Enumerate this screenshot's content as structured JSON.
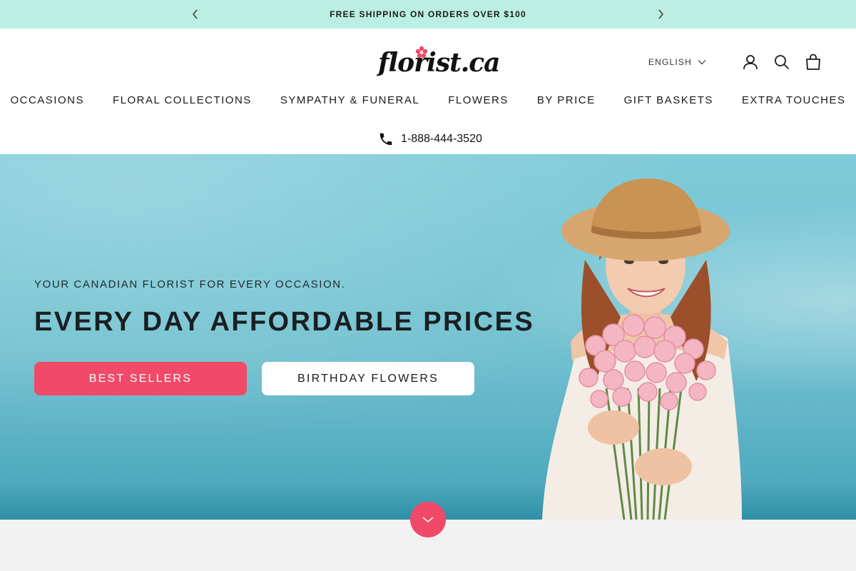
{
  "announcement": {
    "text": "FREE SHIPPING ON ORDERS OVER $100",
    "prev_icon": "chevron-left-icon",
    "next_icon": "chevron-right-icon"
  },
  "header": {
    "logo_text": "florist.ca",
    "language": "ENGLISH",
    "icons": [
      "account-icon",
      "search-icon",
      "cart-icon"
    ],
    "phone": "1-888-444-3520"
  },
  "nav": {
    "items": [
      {
        "label": "OCCASIONS"
      },
      {
        "label": "FLORAL COLLECTIONS"
      },
      {
        "label": "SYMPATHY & FUNERAL"
      },
      {
        "label": "FLOWERS"
      },
      {
        "label": "BY PRICE"
      },
      {
        "label": "GIFT BASKETS"
      },
      {
        "label": "EXTRA TOUCHES"
      }
    ]
  },
  "hero": {
    "subtitle": "YOUR CANADIAN FLORIST FOR EVERY OCCASION.",
    "title": "EVERY DAY AFFORDABLE PRICES",
    "primary_button": "BEST SELLERS",
    "secondary_button": "BIRTHDAY FLOWERS"
  },
  "colors": {
    "announcement_bg": "#bcefe3",
    "accent": "#f04a68",
    "hero_bg": "#70c0cf"
  }
}
